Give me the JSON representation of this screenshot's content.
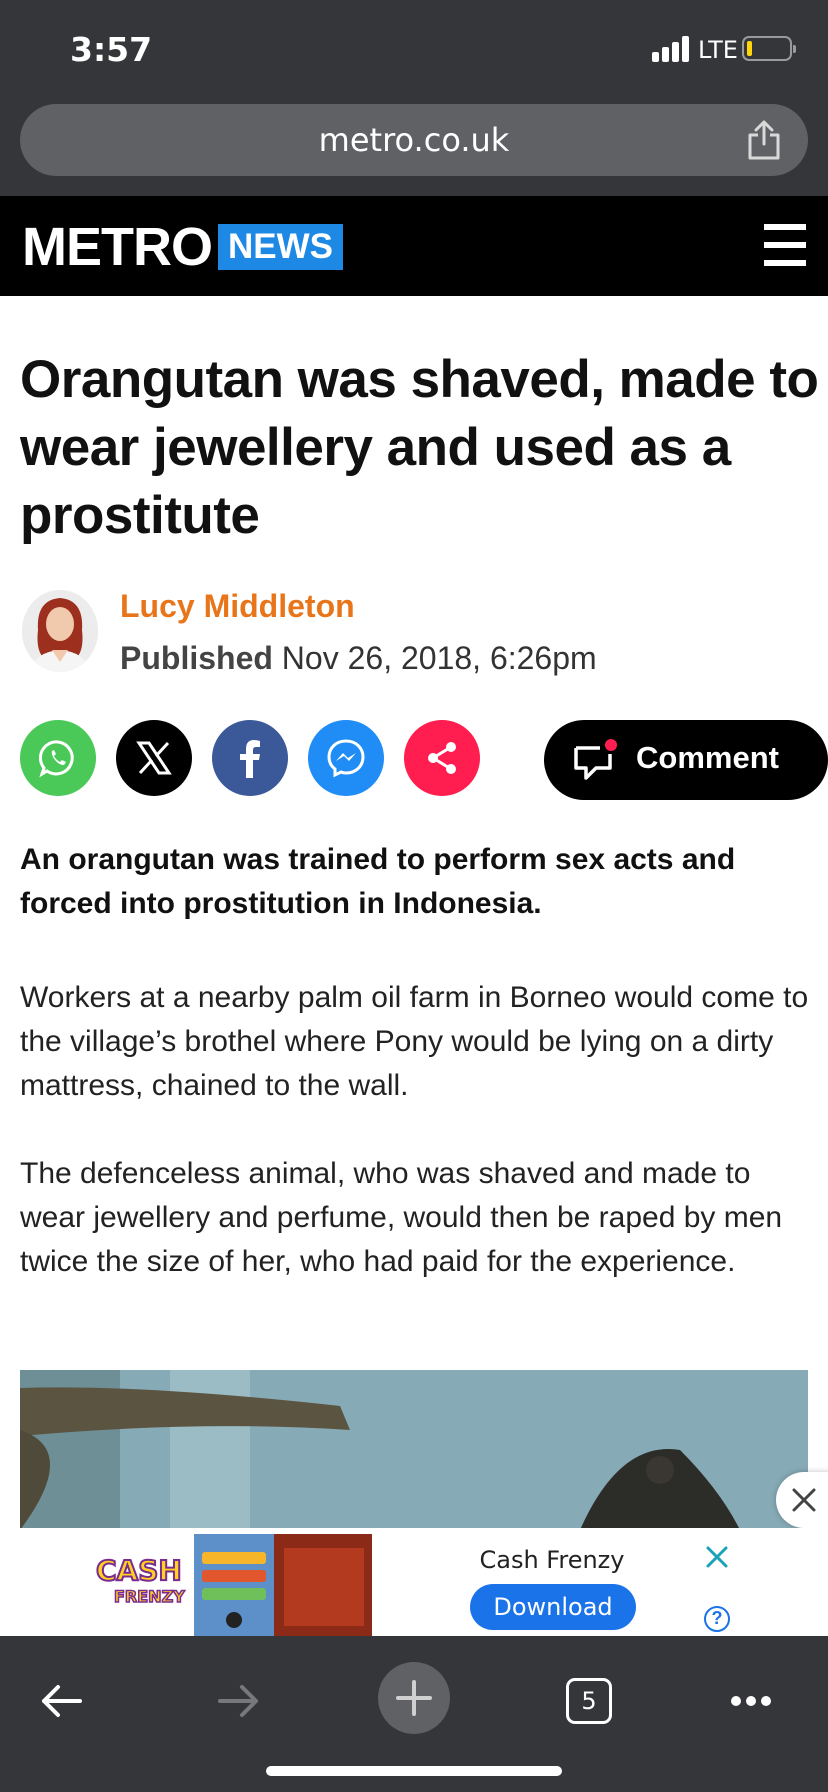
{
  "status_bar": {
    "time": "3:57",
    "network": "LTE"
  },
  "browser": {
    "url": "metro.co.uk",
    "tabs_count": "5"
  },
  "site": {
    "logo": "METRO",
    "section": "NEWS"
  },
  "article": {
    "headline": "Orangutan was shaved, made to wear jewellery and used as a prostitute",
    "author": "Lucy Middleton",
    "published_label": "Published",
    "published_date": "Nov 26, 2018, 6:26pm",
    "comment_label": "Comment",
    "lead": "An orangutan was trained to perform sex acts and forced into prostitution in Indonesia.",
    "paragraphs": [
      "Workers at a nearby palm oil farm in Borneo would come to the village’s brothel where Pony would be lying on a dirty mattress, chained to the wall.",
      "The defenceless animal, who was shaved and made to wear jewellery and perfume, would then be raped by men twice the size of her, who had paid for the experience."
    ]
  },
  "share_buttons": [
    {
      "icon": "whatsapp-icon",
      "color": "#4ac959"
    },
    {
      "icon": "x-icon",
      "color": "#000000"
    },
    {
      "icon": "facebook-icon",
      "color": "#3b5998"
    },
    {
      "icon": "messenger-icon",
      "color": "#1f8df5"
    },
    {
      "icon": "share-icon",
      "color": "#ff1e4f"
    }
  ],
  "ad": {
    "logo_text": "CASH FRENZY",
    "title": "Cash Frenzy",
    "button": "Download",
    "help": "?"
  },
  "colors": {
    "chrome": "#35363a",
    "accent_author": "#e8751a",
    "news_tag": "#1e88e5",
    "ad_button": "#1a73e8"
  }
}
